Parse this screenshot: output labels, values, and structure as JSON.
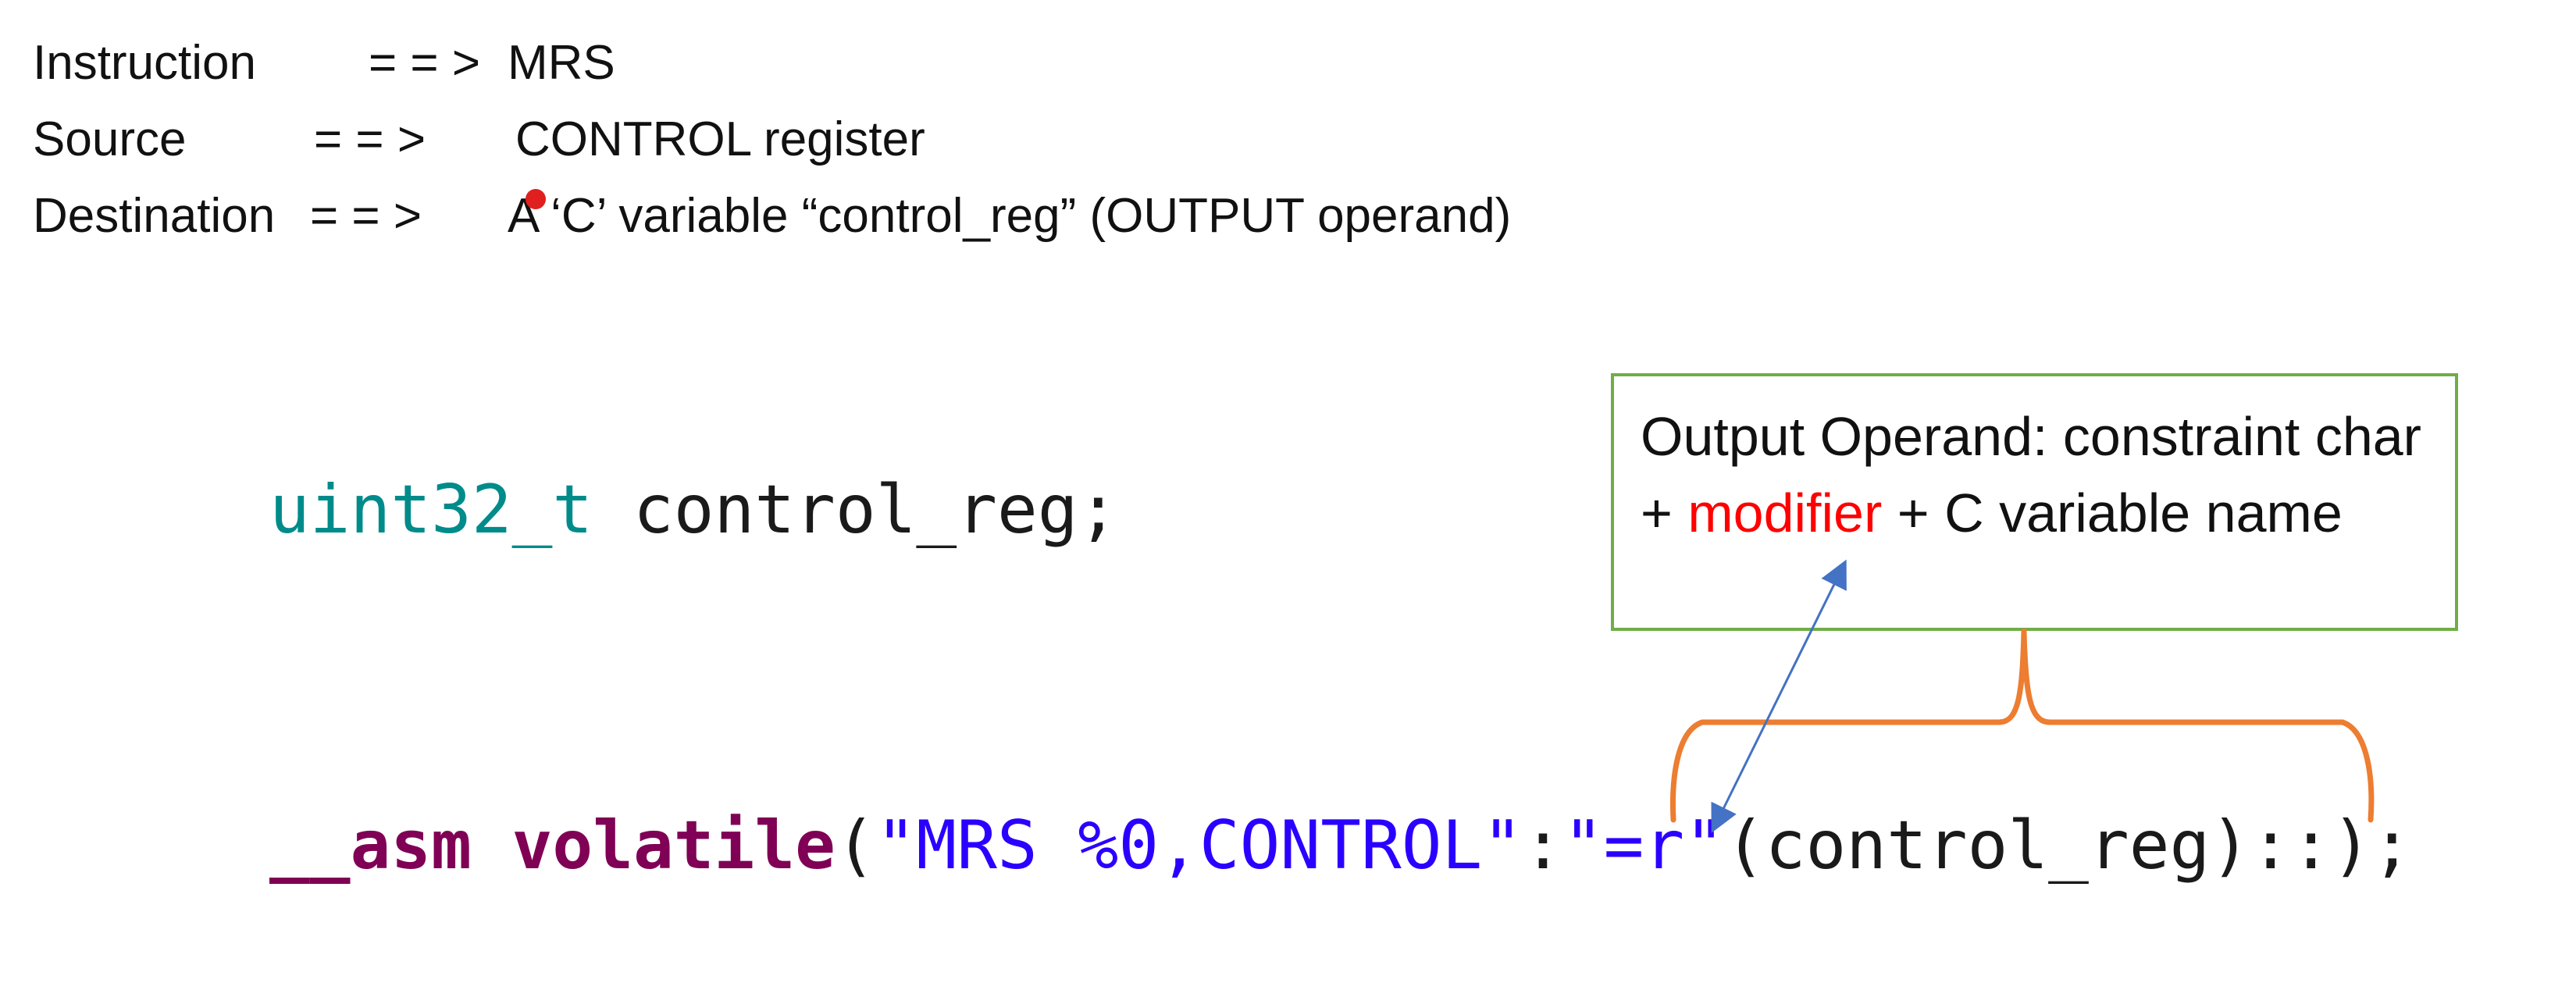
{
  "info": {
    "instruction": {
      "label": "Instruction",
      "arrow": "= = >",
      "value": "MRS"
    },
    "source": {
      "label": "Source",
      "arrow": "= = >",
      "value": "CONTROL register"
    },
    "destination": {
      "label": "Destination",
      "arrow": "= = >",
      "value": "A ‘C’ variable “control_reg” (OUTPUT operand)"
    }
  },
  "code": {
    "decl_type": "uint32_t",
    "decl_rest": " control_reg;",
    "asm_keyword": "__asm volatile",
    "asm_open": "(",
    "asm_template": "\"MRS %0,CONTROL\"",
    "asm_colon": ":",
    "asm_constraint": "\"=r\"",
    "asm_rest": "(control_reg)::);"
  },
  "callout": {
    "text_before": "Output Operand: constraint char + ",
    "highlight": "modifier",
    "text_after": " + C variable name"
  },
  "colors": {
    "type": "#008b8b",
    "keyword": "#7f0055",
    "string": "#2a00ff",
    "callout_border": "#70ad47",
    "brace": "#ed7d31",
    "pointer_arrow": "#4472c4",
    "highlight": "#ff0000"
  }
}
